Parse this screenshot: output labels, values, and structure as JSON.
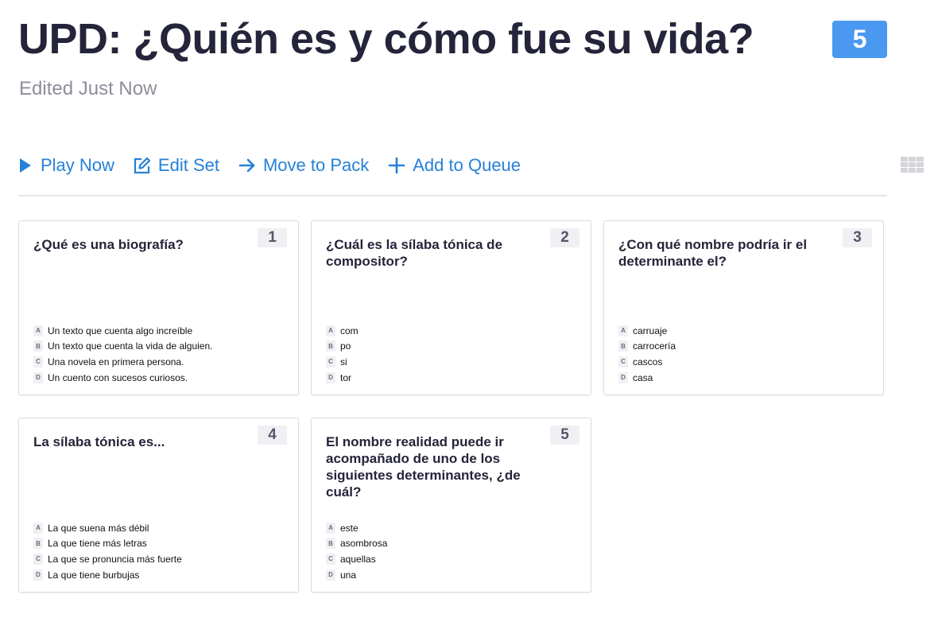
{
  "header": {
    "title": "UPD: ¿Quién es y cómo fue su vida?",
    "subtitle": "Edited Just Now",
    "question_count": "5"
  },
  "toolbar": {
    "items": [
      {
        "label": "Play Now",
        "icon": "play-icon"
      },
      {
        "label": "Edit Set",
        "icon": "edit-icon"
      },
      {
        "label": "Move to Pack",
        "icon": "arrow-right-icon"
      },
      {
        "label": "Add to Queue",
        "icon": "plus-icon"
      }
    ],
    "view_toggle_icon": "grid-view-icon"
  },
  "colors": {
    "accent": "#2680d8",
    "badge": "#4a98f0",
    "title_text": "#24243a",
    "muted_text": "#8d8d9a"
  },
  "questions": [
    {
      "number": "1",
      "text": "¿Qué es una biografía?",
      "answers": [
        {
          "letter": "A",
          "text": "Un texto que cuenta algo increíble"
        },
        {
          "letter": "B",
          "text": "Un texto que cuenta la vida de alguien."
        },
        {
          "letter": "C",
          "text": "Una novela en primera persona."
        },
        {
          "letter": "D",
          "text": "Un cuento con sucesos curiosos."
        }
      ]
    },
    {
      "number": "2",
      "text": "¿Cuál es la sílaba tónica de compositor?",
      "answers": [
        {
          "letter": "A",
          "text": "com"
        },
        {
          "letter": "B",
          "text": "po"
        },
        {
          "letter": "C",
          "text": "si"
        },
        {
          "letter": "D",
          "text": "tor"
        }
      ]
    },
    {
      "number": "3",
      "text": "¿Con qué nombre podría ir el determinante el?",
      "answers": [
        {
          "letter": "A",
          "text": "carruaje"
        },
        {
          "letter": "B",
          "text": "carrocería"
        },
        {
          "letter": "C",
          "text": "cascos"
        },
        {
          "letter": "D",
          "text": "casa"
        }
      ]
    },
    {
      "number": "4",
      "text": "La sílaba tónica es...",
      "answers": [
        {
          "letter": "A",
          "text": "La que suena más débil"
        },
        {
          "letter": "B",
          "text": "La que tiene más letras"
        },
        {
          "letter": "C",
          "text": "La que se pronuncia más fuerte"
        },
        {
          "letter": "D",
          "text": "La que tiene burbujas"
        }
      ]
    },
    {
      "number": "5",
      "text": "El nombre realidad puede ir acompañado de uno de los siguientes determinantes, ¿de cuál?",
      "answers": [
        {
          "letter": "A",
          "text": "este"
        },
        {
          "letter": "B",
          "text": "asombrosa"
        },
        {
          "letter": "C",
          "text": "aquellas"
        },
        {
          "letter": "D",
          "text": "una"
        }
      ]
    }
  ]
}
